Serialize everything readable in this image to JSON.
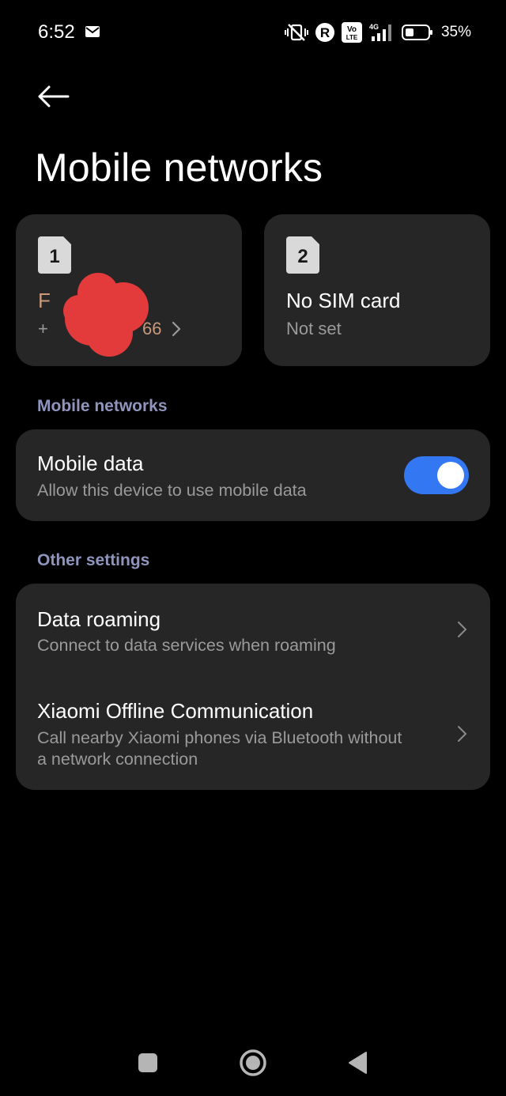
{
  "status_bar": {
    "time": "6:52",
    "battery_percent": "35%",
    "network_badge": "4G",
    "volte_badge_line1": "Vo",
    "volte_badge_line2": "LTE",
    "roaming_badge": "R"
  },
  "page": {
    "title": "Mobile networks"
  },
  "sims": [
    {
      "badge": "1",
      "name": "F",
      "number_prefix": "+",
      "number_suffix": "66"
    },
    {
      "badge": "2",
      "name": "No SIM card",
      "status": "Not set"
    }
  ],
  "mobile_networks_section": {
    "label": "Mobile networks",
    "mobile_data": {
      "title": "Mobile data",
      "subtitle": "Allow this device to use mobile data",
      "enabled": true
    }
  },
  "other_settings_section": {
    "label": "Other settings",
    "items": [
      {
        "title": "Data roaming",
        "subtitle": "Connect to data services when roaming"
      },
      {
        "title": "Xiaomi Offline Communication",
        "subtitle_line1": "Call nearby Xiaomi phones via Bluetooth without",
        "subtitle_line2": "a network connection"
      }
    ]
  },
  "colors": {
    "background": "#000000",
    "card": "#262626",
    "section_label": "#8f95bd",
    "toggle_on": "#3378f2",
    "secondary_text": "#9a9a9a",
    "redaction": "#e33b3b"
  }
}
